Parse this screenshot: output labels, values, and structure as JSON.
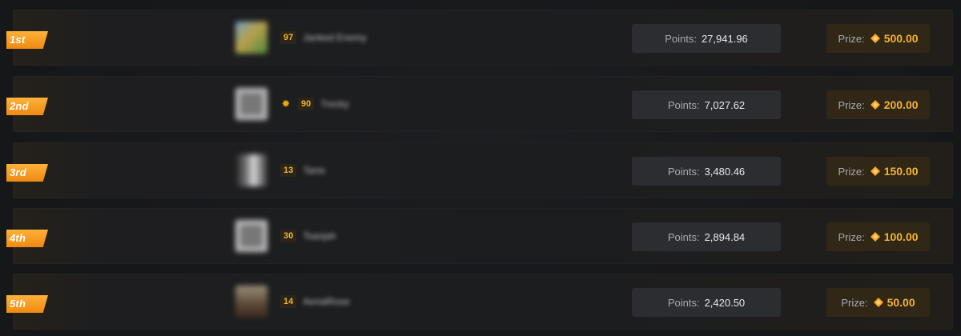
{
  "leaderboard": {
    "points_label": "Points:",
    "prize_label": "Prize:",
    "coin_icon": "diamond-coin-icon",
    "accent_color": "#f5b332",
    "badge_color": "#f59a1c",
    "rows": [
      {
        "rank": "1st",
        "level": "97",
        "name": "Janked Enemy",
        "has_crown": false,
        "points": "27,941.96",
        "prize": "500.00"
      },
      {
        "rank": "2nd",
        "level": "90",
        "name": "Trecky",
        "has_crown": true,
        "points": "7,027.62",
        "prize": "200.00"
      },
      {
        "rank": "3rd",
        "level": "13",
        "name": "Tanis",
        "has_crown": false,
        "points": "3,480.46",
        "prize": "150.00"
      },
      {
        "rank": "4th",
        "level": "30",
        "name": "Tsanjah",
        "has_crown": false,
        "points": "2,894.84",
        "prize": "100.00"
      },
      {
        "rank": "5th",
        "level": "14",
        "name": "AerialRose",
        "has_crown": false,
        "points": "2,420.50",
        "prize": "50.00"
      }
    ]
  }
}
